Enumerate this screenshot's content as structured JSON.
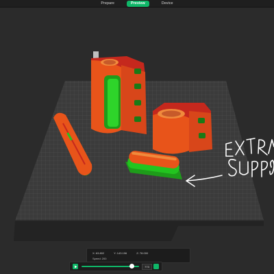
{
  "nav": {
    "tabs": [
      {
        "label": "Prepare",
        "active": false
      },
      {
        "label": "Preview",
        "active": true
      },
      {
        "label": "Device",
        "active": false
      }
    ]
  },
  "annotation": {
    "line1": "EXTRA",
    "line2": "SUPPORTS",
    "color": "#ffffff"
  },
  "colors": {
    "model": "#e8541a",
    "support": "#22c41f",
    "accent": "#0fb768",
    "bed": "#3e3e3e"
  },
  "legend": {
    "x": "X: 63.802",
    "y": "Y: 143.196",
    "z": "Z: 78.000",
    "speed": "Speed: 200"
  },
  "playback": {
    "progress": 0.88,
    "layer": "773"
  }
}
